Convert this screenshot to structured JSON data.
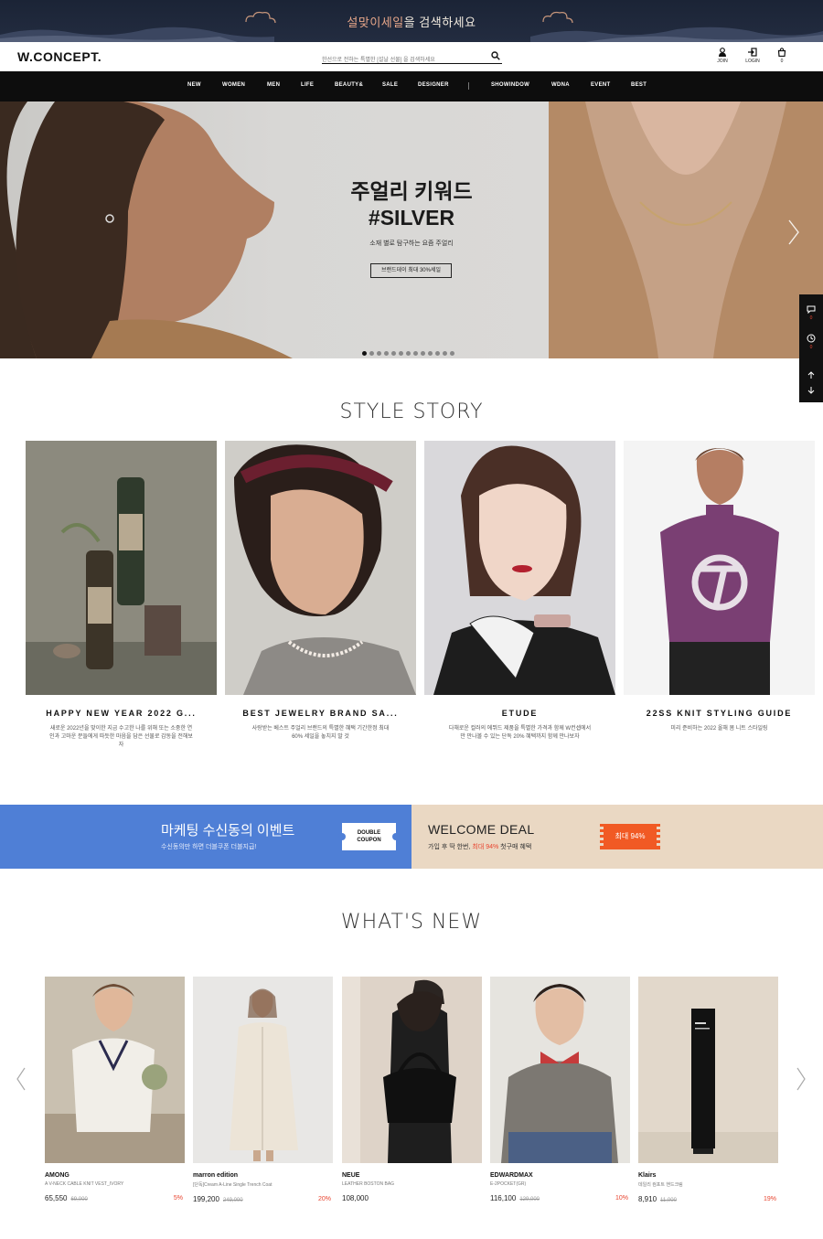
{
  "top_banner": {
    "highlight": "설맞이세일",
    "text": "을 검색하세요"
  },
  "header": {
    "logo": "W.CONCEPT.",
    "search_placeholder": "한선으로 전하는 특별한 [설날 선물] 을 검색하세요",
    "join": "JOIN",
    "login": "LOGIN",
    "cart_count": "0"
  },
  "nav": [
    "NEW",
    "WOMEN",
    "MEN",
    "LIFE",
    "BEAUTY&",
    "SALE",
    "DESIGNER",
    "SHOWINDOW",
    "WDNA",
    "EVENT",
    "BEST"
  ],
  "hero": {
    "line1": "주얼리 키워드",
    "line2": "#SILVER",
    "sub": "소재 별로 탐구하는 요즘 주얼리",
    "cta": "브랜드데이 최대 30%세일",
    "slides": 13,
    "active_slide": 1
  },
  "quickbar": {
    "chat_count": "0",
    "recent_count": "0"
  },
  "style_story": {
    "title": "STYLE STORY",
    "cards": [
      {
        "title": "HAPPY NEW YEAR 2022 G...",
        "desc": "새로운 2022년을 맞이한 지금 수고한 나를 위해 또는 소중한 연인과 고마운 분들에게 따듯한 마음을 담은 선물로 감동을 전해보자"
      },
      {
        "title": "BEST JEWELRY BRAND SA...",
        "desc": "사랑받는 베스트 주얼리 브랜드의 특별한 혜택 기간한정 최대 60% 세일을 놓치지 말 것"
      },
      {
        "title": "ETUDE",
        "desc": "다채로운 컬러의 에뛰드 제품을 특별한 가격과 함께 W컨셉에서만 만나볼 수 있는 단독 20% 혜택까지 함께 만나보자"
      },
      {
        "title": "22SS KNIT STYLING GUIDE",
        "desc": "미리 준비하는 2022 올해 봄 니트 스타일링"
      }
    ]
  },
  "promo": {
    "left_title": "마케팅 수신동의 이벤트",
    "left_sub": "수신동의만 하면 더블쿠폰 더블지급!",
    "coupon_line1": "DOUBLE",
    "coupon_line2": "COUPON",
    "right_title": "WELCOME DEAL",
    "right_sub_a": "가입 후 딱 한번,",
    "right_sub_hl": "최대 94%",
    "right_sub_b": "첫구매 혜택",
    "tag": "최대 94%"
  },
  "whats_new": {
    "title": "WHAT'S NEW",
    "products": [
      {
        "brand": "AMONG",
        "name": "A V-NECK CABLE KNIT VEST_IVORY",
        "price": "65,550",
        "orig": "69,000",
        "disc": "5%"
      },
      {
        "brand": "marron edition",
        "name": "[단독]Cream A-Line Single Trench Coat",
        "price": "199,200",
        "orig": "249,000",
        "disc": "20%"
      },
      {
        "brand": "NEUE",
        "name": "LEATHER BOSTON BAG",
        "price": "108,000",
        "orig": "",
        "disc": ""
      },
      {
        "brand": "EDWARDMAX",
        "name": "E-2POCKET(GR)",
        "price": "116,100",
        "orig": "129,000",
        "disc": "10%"
      },
      {
        "brand": "Klairs",
        "name": "데일리 컴포트 핸드크림",
        "price": "8,910",
        "orig": "11,000",
        "disc": "19%"
      }
    ]
  },
  "colors": {
    "nav_bg": "#0d0d0d",
    "promo_blue": "#4f7fd6",
    "promo_beige": "#ead8c3",
    "accent_red": "#e8442f"
  }
}
